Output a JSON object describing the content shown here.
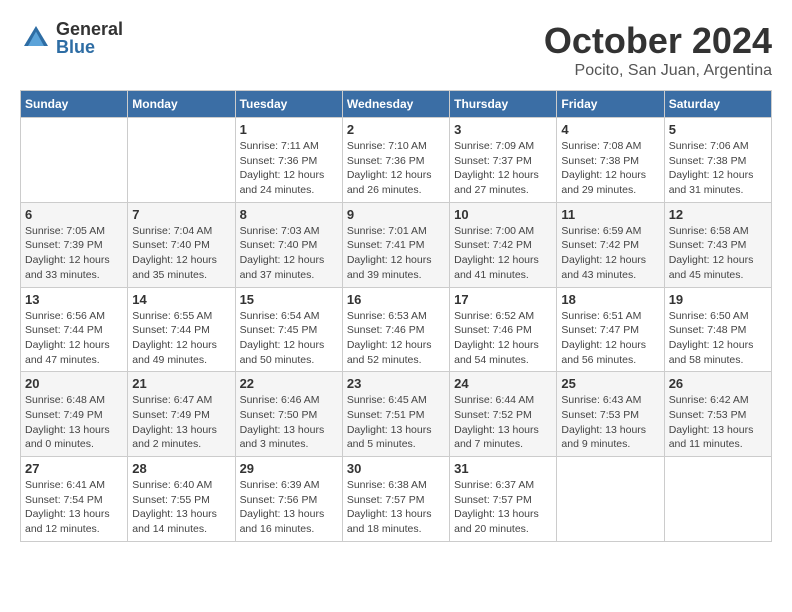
{
  "header": {
    "logo_general": "General",
    "logo_blue": "Blue",
    "month_title": "October 2024",
    "location": "Pocito, San Juan, Argentina"
  },
  "weekdays": [
    "Sunday",
    "Monday",
    "Tuesday",
    "Wednesday",
    "Thursday",
    "Friday",
    "Saturday"
  ],
  "weeks": [
    [
      {
        "day": "",
        "detail": ""
      },
      {
        "day": "",
        "detail": ""
      },
      {
        "day": "1",
        "detail": "Sunrise: 7:11 AM\nSunset: 7:36 PM\nDaylight: 12 hours\nand 24 minutes."
      },
      {
        "day": "2",
        "detail": "Sunrise: 7:10 AM\nSunset: 7:36 PM\nDaylight: 12 hours\nand 26 minutes."
      },
      {
        "day": "3",
        "detail": "Sunrise: 7:09 AM\nSunset: 7:37 PM\nDaylight: 12 hours\nand 27 minutes."
      },
      {
        "day": "4",
        "detail": "Sunrise: 7:08 AM\nSunset: 7:38 PM\nDaylight: 12 hours\nand 29 minutes."
      },
      {
        "day": "5",
        "detail": "Sunrise: 7:06 AM\nSunset: 7:38 PM\nDaylight: 12 hours\nand 31 minutes."
      }
    ],
    [
      {
        "day": "6",
        "detail": "Sunrise: 7:05 AM\nSunset: 7:39 PM\nDaylight: 12 hours\nand 33 minutes."
      },
      {
        "day": "7",
        "detail": "Sunrise: 7:04 AM\nSunset: 7:40 PM\nDaylight: 12 hours\nand 35 minutes."
      },
      {
        "day": "8",
        "detail": "Sunrise: 7:03 AM\nSunset: 7:40 PM\nDaylight: 12 hours\nand 37 minutes."
      },
      {
        "day": "9",
        "detail": "Sunrise: 7:01 AM\nSunset: 7:41 PM\nDaylight: 12 hours\nand 39 minutes."
      },
      {
        "day": "10",
        "detail": "Sunrise: 7:00 AM\nSunset: 7:42 PM\nDaylight: 12 hours\nand 41 minutes."
      },
      {
        "day": "11",
        "detail": "Sunrise: 6:59 AM\nSunset: 7:42 PM\nDaylight: 12 hours\nand 43 minutes."
      },
      {
        "day": "12",
        "detail": "Sunrise: 6:58 AM\nSunset: 7:43 PM\nDaylight: 12 hours\nand 45 minutes."
      }
    ],
    [
      {
        "day": "13",
        "detail": "Sunrise: 6:56 AM\nSunset: 7:44 PM\nDaylight: 12 hours\nand 47 minutes."
      },
      {
        "day": "14",
        "detail": "Sunrise: 6:55 AM\nSunset: 7:44 PM\nDaylight: 12 hours\nand 49 minutes."
      },
      {
        "day": "15",
        "detail": "Sunrise: 6:54 AM\nSunset: 7:45 PM\nDaylight: 12 hours\nand 50 minutes."
      },
      {
        "day": "16",
        "detail": "Sunrise: 6:53 AM\nSunset: 7:46 PM\nDaylight: 12 hours\nand 52 minutes."
      },
      {
        "day": "17",
        "detail": "Sunrise: 6:52 AM\nSunset: 7:46 PM\nDaylight: 12 hours\nand 54 minutes."
      },
      {
        "day": "18",
        "detail": "Sunrise: 6:51 AM\nSunset: 7:47 PM\nDaylight: 12 hours\nand 56 minutes."
      },
      {
        "day": "19",
        "detail": "Sunrise: 6:50 AM\nSunset: 7:48 PM\nDaylight: 12 hours\nand 58 minutes."
      }
    ],
    [
      {
        "day": "20",
        "detail": "Sunrise: 6:48 AM\nSunset: 7:49 PM\nDaylight: 13 hours\nand 0 minutes."
      },
      {
        "day": "21",
        "detail": "Sunrise: 6:47 AM\nSunset: 7:49 PM\nDaylight: 13 hours\nand 2 minutes."
      },
      {
        "day": "22",
        "detail": "Sunrise: 6:46 AM\nSunset: 7:50 PM\nDaylight: 13 hours\nand 3 minutes."
      },
      {
        "day": "23",
        "detail": "Sunrise: 6:45 AM\nSunset: 7:51 PM\nDaylight: 13 hours\nand 5 minutes."
      },
      {
        "day": "24",
        "detail": "Sunrise: 6:44 AM\nSunset: 7:52 PM\nDaylight: 13 hours\nand 7 minutes."
      },
      {
        "day": "25",
        "detail": "Sunrise: 6:43 AM\nSunset: 7:53 PM\nDaylight: 13 hours\nand 9 minutes."
      },
      {
        "day": "26",
        "detail": "Sunrise: 6:42 AM\nSunset: 7:53 PM\nDaylight: 13 hours\nand 11 minutes."
      }
    ],
    [
      {
        "day": "27",
        "detail": "Sunrise: 6:41 AM\nSunset: 7:54 PM\nDaylight: 13 hours\nand 12 minutes."
      },
      {
        "day": "28",
        "detail": "Sunrise: 6:40 AM\nSunset: 7:55 PM\nDaylight: 13 hours\nand 14 minutes."
      },
      {
        "day": "29",
        "detail": "Sunrise: 6:39 AM\nSunset: 7:56 PM\nDaylight: 13 hours\nand 16 minutes."
      },
      {
        "day": "30",
        "detail": "Sunrise: 6:38 AM\nSunset: 7:57 PM\nDaylight: 13 hours\nand 18 minutes."
      },
      {
        "day": "31",
        "detail": "Sunrise: 6:37 AM\nSunset: 7:57 PM\nDaylight: 13 hours\nand 20 minutes."
      },
      {
        "day": "",
        "detail": ""
      },
      {
        "day": "",
        "detail": ""
      }
    ]
  ]
}
